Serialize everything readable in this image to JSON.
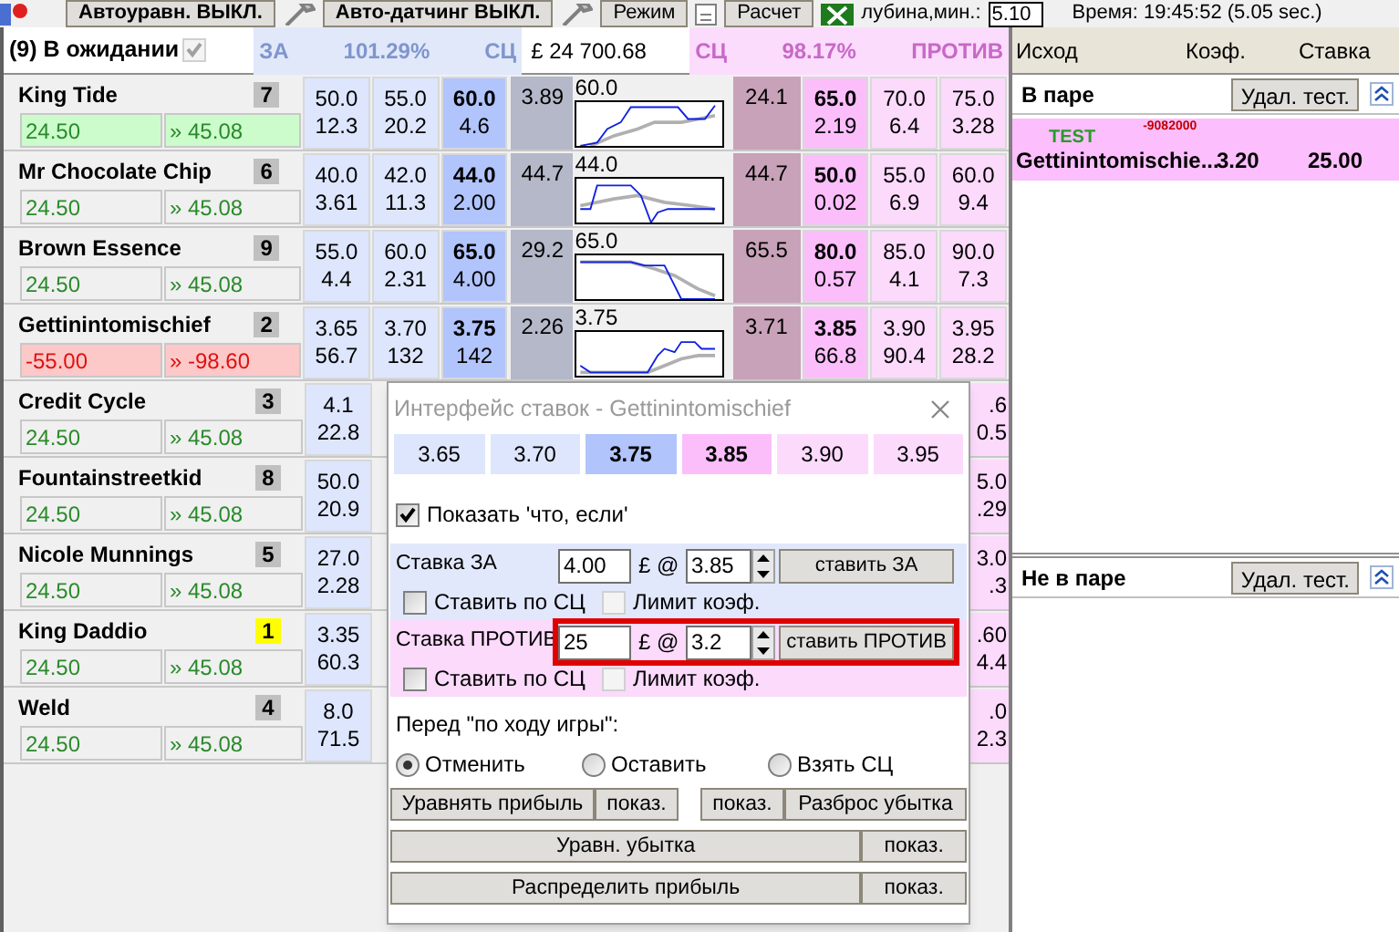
{
  "toolbar": {
    "items": [
      {
        "kind": "icon"
      },
      {
        "kind": "button",
        "label": "Автоуравн. ВЫКЛ."
      },
      {
        "kind": "icon"
      },
      {
        "kind": "button",
        "label": "Авто-датчинг ВЫКЛ."
      },
      {
        "kind": "icon"
      },
      {
        "kind": "button",
        "label": "Режим"
      },
      {
        "kind": "icon"
      },
      {
        "kind": "button",
        "label": "Расчет"
      },
      {
        "kind": "icon"
      }
    ],
    "depth_label": "лубина,мин.:",
    "depth_value": "5.10",
    "time": "Время: 19:45:52 (5.05 sec.)"
  },
  "market": {
    "title": "(9) В ожидании",
    "title_check": {
      "checked": true
    },
    "back_header": [
      "ЗА",
      "101.29%",
      "СЦ"
    ],
    "matched_total": "£ 24 700.68",
    "lay_header": [
      "СЦ",
      "98.17%",
      "ПРОТИВ"
    ]
  },
  "runners": [
    {
      "name": "King Tide",
      "number": "7",
      "color": "#c0c0c0",
      "kind": "profit_highlight",
      "pnl": "24.50",
      "pnl_if": "» 45.08",
      "back": [
        [
          "50.0",
          "12.3"
        ],
        [
          "55.0",
          "20.2"
        ],
        [
          "60.0",
          "4.6"
        ]
      ],
      "back_sp": "3.89",
      "chart_label": "60.0",
      "lay_sp": "24.1",
      "lay": [
        [
          "65.0",
          "2.19"
        ],
        [
          "70.0",
          "6.4"
        ],
        [
          "75.0",
          "3.28"
        ]
      ]
    },
    {
      "name": "Mr Chocolate Chip",
      "number": "6",
      "color": "#c0c0c0",
      "kind": "neutral",
      "pnl": "24.50",
      "pnl_if": "» 45.08",
      "back": [
        [
          "40.0",
          "3.61"
        ],
        [
          "42.0",
          "11.3"
        ],
        [
          "44.0",
          "2.00"
        ]
      ],
      "back_sp": "44.7",
      "chart_label": "44.0",
      "lay_sp": "44.7",
      "lay": [
        [
          "50.0",
          "0.02"
        ],
        [
          "55.0",
          "6.9"
        ],
        [
          "60.0",
          "9.4"
        ]
      ]
    },
    {
      "name": "Brown Essence",
      "number": "9",
      "color": "#c0c0c0",
      "kind": "neutral",
      "pnl": "24.50",
      "pnl_if": "» 45.08",
      "back": [
        [
          "55.0",
          "4.4"
        ],
        [
          "60.0",
          "2.31"
        ],
        [
          "65.0",
          "4.00"
        ]
      ],
      "back_sp": "29.2",
      "chart_label": "65.0",
      "lay_sp": "65.5",
      "lay": [
        [
          "80.0",
          "0.57"
        ],
        [
          "85.0",
          "4.1"
        ],
        [
          "90.0",
          "7.3"
        ]
      ]
    },
    {
      "name": "Gettinintomischief",
      "number": "2",
      "color": "#c0c0c0",
      "kind": "loss",
      "pnl": "-55.00",
      "pnl_if": "» -98.60",
      "back": [
        [
          "3.65",
          "56.7"
        ],
        [
          "3.70",
          "132"
        ],
        [
          "3.75",
          "142"
        ]
      ],
      "back_sp": "2.26",
      "chart_label": "3.75",
      "lay_sp": "3.71",
      "lay": [
        [
          "3.85",
          "66.8"
        ],
        [
          "3.90",
          "90.4"
        ],
        [
          "3.95",
          "28.2"
        ]
      ]
    },
    {
      "name": "Credit Cycle",
      "number": "3",
      "color": "#c0c0c0",
      "kind": "neutral",
      "pnl": "24.50",
      "pnl_if": "» 45.08",
      "back_outer": [
        "4.1",
        "22.8"
      ],
      "lay_outer": [
        ".6",
        "0.5"
      ]
    },
    {
      "name": "Fountainstreetkid",
      "number": "8",
      "color": "#c0c0c0",
      "kind": "neutral",
      "pnl": "24.50",
      "pnl_if": "» 45.08",
      "back_outer": [
        "50.0",
        "20.9"
      ],
      "lay_outer": [
        "5.0",
        ".29"
      ]
    },
    {
      "name": "Nicole Munnings",
      "number": "5",
      "color": "#c0c0c0",
      "kind": "neutral",
      "pnl": "24.50",
      "pnl_if": "» 45.08",
      "back_outer": [
        "27.0",
        "2.28"
      ],
      "lay_outer": [
        "3.0",
        ".3"
      ]
    },
    {
      "name": "King Daddio",
      "number": "1",
      "color": "#ffff00",
      "kind": "neutral",
      "pnl": "24.50",
      "pnl_if": "» 45.08",
      "back_outer": [
        "3.35",
        "60.3"
      ],
      "lay_outer": [
        ".60",
        "4.4"
      ]
    },
    {
      "name": "Weld",
      "number": "4",
      "color": "#c0c0c0",
      "kind": "neutral",
      "pnl": "24.50",
      "pnl_if": "» 45.08",
      "back_outer": [
        "8.0",
        "71.5"
      ],
      "lay_outer": [
        ".0",
        "2.3"
      ]
    }
  ],
  "bets_panel": {
    "columns": [
      "Исход",
      "Коэф.",
      "Ставка"
    ],
    "sections": [
      {
        "title": "В паре",
        "button": "Удал. тест.",
        "bets": [
          {
            "tag": "TEST",
            "ref": "-9082000",
            "runner": "Gettinintomischie...",
            "odds": "3.20",
            "stake": "25.00"
          }
        ]
      },
      {
        "title": "Не в паре",
        "button": "Удал. тест."
      }
    ]
  },
  "dialog": {
    "title": "Интерфейс ставок - Gettinintomischief",
    "ladder": [
      {
        "price": "3.65",
        "kind": "back",
        "selected": false
      },
      {
        "price": "3.70",
        "kind": "back",
        "selected": false
      },
      {
        "price": "3.75",
        "kind": "back",
        "selected": true
      },
      {
        "price": "3.85",
        "kind": "lay",
        "selected": true
      },
      {
        "price": "3.90",
        "kind": "lay",
        "selected": false
      },
      {
        "price": "3.95",
        "kind": "lay",
        "selected": false
      }
    ],
    "what_if": {
      "label": "Показать 'что, если'",
      "checked": true
    },
    "forms": [
      {
        "kind": "back",
        "label": "Ставка ЗА",
        "stake": "4.00",
        "currency": "£ @",
        "odds": "3.85",
        "button": "ставить ЗА",
        "highlighted": false,
        "options": [
          {
            "label": "Ставить по СЦ",
            "checked": false,
            "disabled": false
          },
          {
            "label": "Лимит коэф.",
            "checked": false,
            "disabled": true
          }
        ]
      },
      {
        "kind": "lay",
        "label": "Ставка ПРОТИВ",
        "stake": "25",
        "currency": "£ @",
        "odds": "3.2",
        "button": "ставить ПРОТИВ",
        "highlighted": true,
        "options": [
          {
            "label": "Ставить по СЦ",
            "checked": false,
            "disabled": false
          },
          {
            "label": "Лимит коэф.",
            "checked": false,
            "disabled": true
          }
        ]
      }
    ],
    "inplay": {
      "label": "Перед \"по ходу игры\":",
      "options": [
        {
          "label": "Отменить",
          "selected": true
        },
        {
          "label": "Оставить",
          "selected": false
        },
        {
          "label": "Взять СЦ",
          "selected": false
        }
      ]
    },
    "split_row": {
      "left": [
        "Уравнять прибыль",
        "показ."
      ],
      "right": [
        "показ.",
        "Разброс убытка"
      ]
    },
    "wide_rows": [
      {
        "label": "Уравн. убытка",
        "side": "показ."
      },
      {
        "label": "Распределить прибыль",
        "side": "показ."
      }
    ]
  }
}
